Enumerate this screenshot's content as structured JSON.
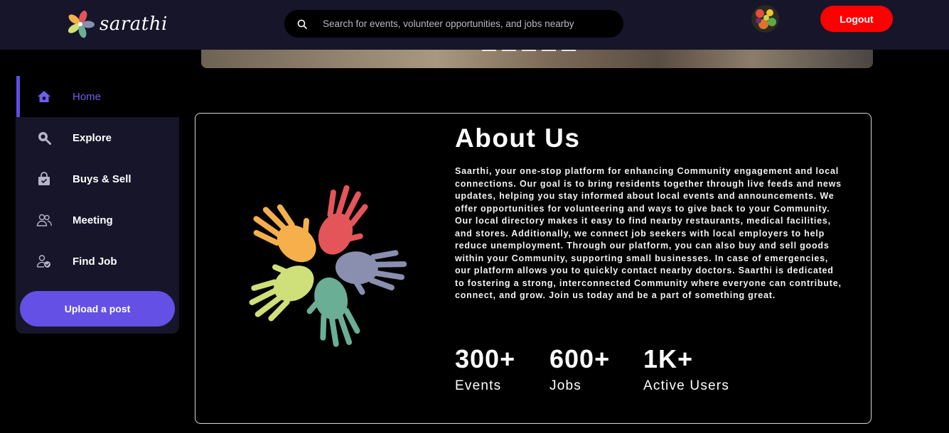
{
  "header": {
    "logo_text": "sarathi",
    "search_placeholder": "Search for events, volunteer opportunities, and jobs nearby",
    "logout_label": "Logout"
  },
  "sidebar": {
    "items": [
      {
        "label": "Home",
        "icon": "home-icon",
        "active": true
      },
      {
        "label": "Explore",
        "icon": "search-icon",
        "active": false
      },
      {
        "label": "Buys & Sell",
        "icon": "shopping-bag-icon",
        "active": false
      },
      {
        "label": "Meeting",
        "icon": "users-icon",
        "active": false
      },
      {
        "label": "Find Job",
        "icon": "user-check-icon",
        "active": false
      }
    ],
    "upload_label": "Upload a post"
  },
  "about": {
    "title": "About Us",
    "text": "Saarthi, your one-stop platform for enhancing Community engagement and local connections. Our goal is to bring residents together through live feeds and news updates, helping you stay informed about local events and announcements. We offer opportunities for volunteering and ways to give back to your Community. Our local directory makes it easy to find nearby restaurants, medical facilities, and stores. Additionally, we connect job seekers with local employers to help reduce unemployment. Through our platform, you can also buy and sell goods within your Community, supporting small businesses. In case of emergencies, our platform allows you to quickly contact nearby doctors. Saarthi is dedicated to fostering a strong, interconnected Community where everyone can contribute, connect, and grow. Join us today and be a part of something great.",
    "stats": [
      {
        "value": "300+",
        "label": "Events"
      },
      {
        "value": "600+",
        "label": "Jobs"
      },
      {
        "value": "1K+",
        "label": "Active Users"
      }
    ]
  },
  "colors": {
    "accent": "#6550e6",
    "logout": "#ff0000",
    "topbar": "#16152a",
    "hand_colors": [
      "#f5b04c",
      "#e4555a",
      "#8a8fb0",
      "#6aae95",
      "#cfe07a"
    ]
  }
}
